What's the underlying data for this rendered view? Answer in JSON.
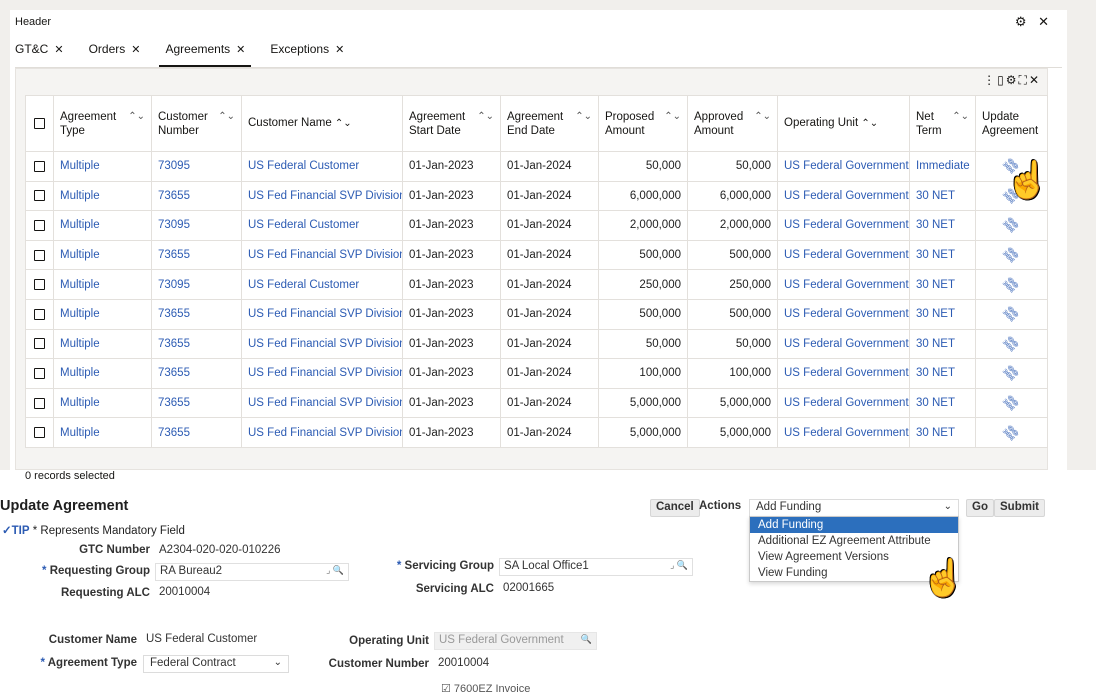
{
  "header": {
    "title": "Header",
    "gear_icon": "⚙",
    "close_icon": "✕"
  },
  "tabs": [
    {
      "label": "GT&C",
      "active": false
    },
    {
      "label": "Orders",
      "active": false
    },
    {
      "label": "Agreements",
      "active": true
    },
    {
      "label": "Exceptions",
      "active": false
    }
  ],
  "table_toolbar": {
    "icons": [
      "more-vertical-icon",
      "panel-icon",
      "gear-icon",
      "expand-icon",
      "close-icon"
    ]
  },
  "table": {
    "columns": [
      "Agreement Type",
      "Customer Number",
      "Customer Name",
      "Agreement Start Date",
      "Agreement End Date",
      "Proposed Amount",
      "Approved Amount",
      "Operating Unit",
      "Net Term",
      "Update Agreement"
    ],
    "rows": [
      {
        "type": "Multiple",
        "cust_no": "73095",
        "cust_name": "US Federal Customer",
        "start": "01-Jan-2023",
        "end": "01-Jan-2024",
        "proposed": "50,000",
        "approved": "50,000",
        "unit": "US Federal Government",
        "term": "Immediate"
      },
      {
        "type": "Multiple",
        "cust_no": "73655",
        "cust_name": "US Fed Financial SVP Division",
        "start": "01-Jan-2023",
        "end": "01-Jan-2024",
        "proposed": "6,000,000",
        "approved": "6,000,000",
        "unit": "US Federal Government",
        "term": "30 NET"
      },
      {
        "type": "Multiple",
        "cust_no": "73095",
        "cust_name": "US Federal Customer",
        "start": "01-Jan-2023",
        "end": "01-Jan-2024",
        "proposed": "2,000,000",
        "approved": "2,000,000",
        "unit": "US Federal Government",
        "term": "30 NET"
      },
      {
        "type": "Multiple",
        "cust_no": "73655",
        "cust_name": "US Fed Financial SVP Division",
        "start": "01-Jan-2023",
        "end": "01-Jan-2024",
        "proposed": "500,000",
        "approved": "500,000",
        "unit": "US Federal Government",
        "term": "30 NET"
      },
      {
        "type": "Multiple",
        "cust_no": "73095",
        "cust_name": "US Federal Customer",
        "start": "01-Jan-2023",
        "end": "01-Jan-2024",
        "proposed": "250,000",
        "approved": "250,000",
        "unit": "US Federal Government",
        "term": "30 NET"
      },
      {
        "type": "Multiple",
        "cust_no": "73655",
        "cust_name": "US Fed Financial SVP Division",
        "start": "01-Jan-2023",
        "end": "01-Jan-2024",
        "proposed": "500,000",
        "approved": "500,000",
        "unit": "US Federal Government",
        "term": "30 NET"
      },
      {
        "type": "Multiple",
        "cust_no": "73655",
        "cust_name": "US Fed Financial SVP Division",
        "start": "01-Jan-2023",
        "end": "01-Jan-2024",
        "proposed": "50,000",
        "approved": "50,000",
        "unit": "US Federal Government",
        "term": "30 NET"
      },
      {
        "type": "Multiple",
        "cust_no": "73655",
        "cust_name": "US Fed Financial SVP Division",
        "start": "01-Jan-2023",
        "end": "01-Jan-2024",
        "proposed": "100,000",
        "approved": "100,000",
        "unit": "US Federal Government",
        "term": "30 NET"
      },
      {
        "type": "Multiple",
        "cust_no": "73655",
        "cust_name": "US Fed Financial SVP Division",
        "start": "01-Jan-2023",
        "end": "01-Jan-2024",
        "proposed": "5,000,000",
        "approved": "5,000,000",
        "unit": "US Federal Government",
        "term": "30 NET"
      },
      {
        "type": "Multiple",
        "cust_no": "73655",
        "cust_name": "US Fed Financial SVP Division",
        "start": "01-Jan-2023",
        "end": "01-Jan-2024",
        "proposed": "5,000,000",
        "approved": "5,000,000",
        "unit": "US Federal Government",
        "term": "30 NET"
      }
    ],
    "records_selected": "0 records selected"
  },
  "form": {
    "title": "Update Agreement",
    "tip_label": "TIP",
    "tip_text": "* Represents Mandatory Field",
    "cancel": "Cancel",
    "actions_label": "Actions",
    "actions_value": "Add Funding",
    "go": "Go",
    "submit": "Submit",
    "actions_options": [
      "Add Funding",
      "Additional EZ Agreement Attribute",
      "View Agreement Versions",
      "View Funding"
    ],
    "gtc_number_label": "GTC Number",
    "gtc_number": "A2304-020-020-010226",
    "requesting_group_label": "Requesting Group",
    "requesting_group": "RA Bureau2",
    "requesting_alc_label": "Requesting ALC",
    "requesting_alc": "20010004",
    "servicing_group_label": "Servicing Group",
    "servicing_group": "SA Local Office1",
    "servicing_alc_label": "Servicing ALC",
    "servicing_alc": "02001665",
    "customer_name_label": "Customer Name",
    "customer_name": "US Federal Customer",
    "operating_unit_label": "Operating Unit",
    "operating_unit": "US Federal Government",
    "agreement_type_label": "Agreement Type",
    "agreement_type": "Federal Contract",
    "customer_number_label": "Customer Number",
    "customer_number": "20010004",
    "checkbox_label": "7600EZ Invoice"
  }
}
